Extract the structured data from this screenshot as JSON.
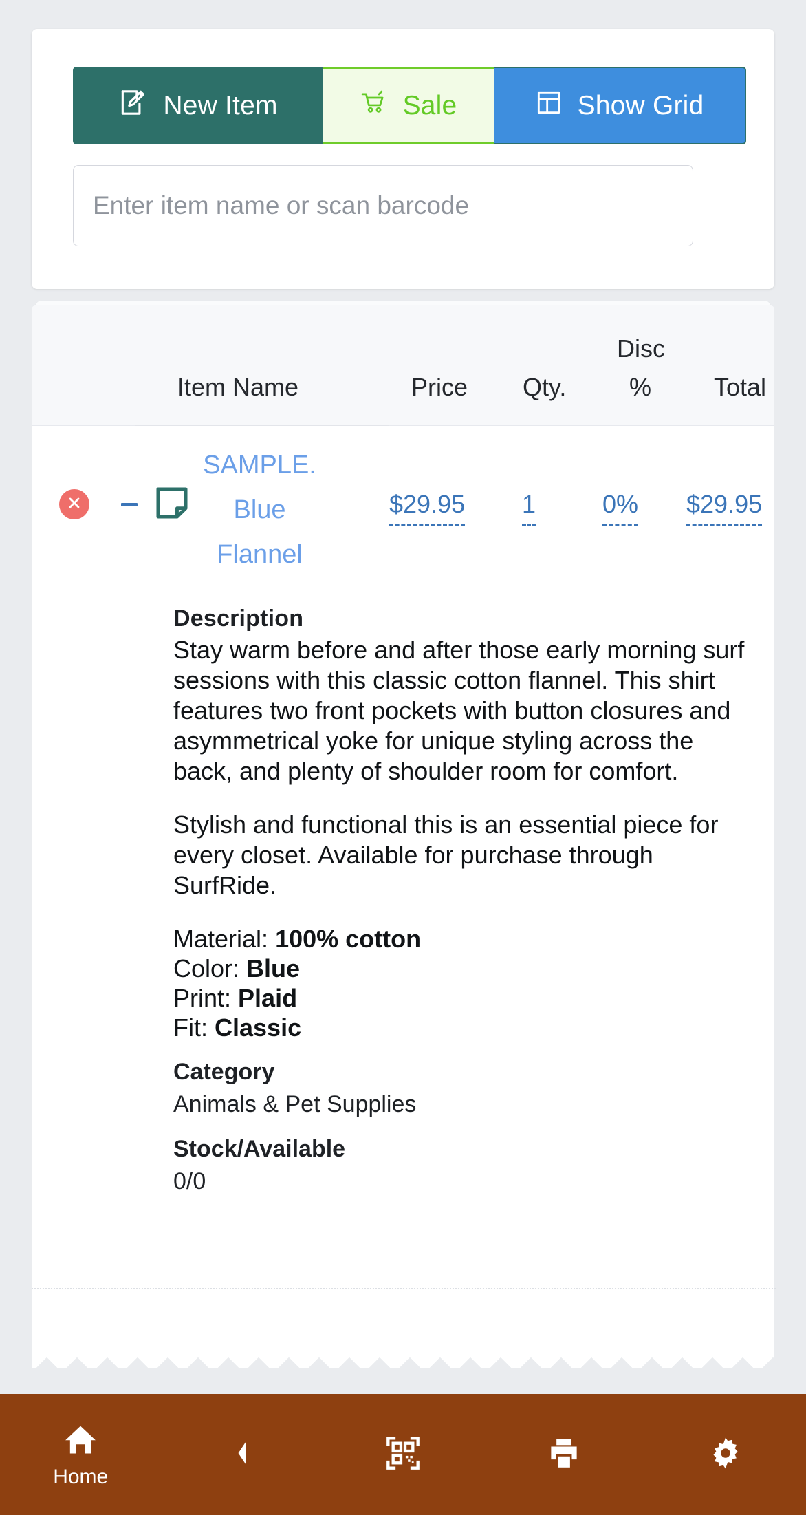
{
  "toolbar": {
    "new_item_label": "New Item",
    "sale_label": "Sale",
    "show_grid_label": "Show Grid",
    "new_item_icon": "edit-note-icon",
    "sale_icon": "shopping-cart-icon",
    "show_grid_icon": "grid-layout-icon",
    "colors": {
      "new_item_bg": "#2d7069",
      "sale_bg": "#f2fbe6",
      "sale_text": "#63ca26",
      "sale_border": "#6fcc2a",
      "show_grid_bg": "#3e8ede"
    }
  },
  "search": {
    "value": "",
    "placeholder": "Enter item name or scan barcode"
  },
  "table": {
    "headers": {
      "item_name": "Item Name",
      "price": "Price",
      "qty": "Qty.",
      "disc_top": "Disc",
      "disc_bottom": "%",
      "total": "Total"
    },
    "rows": [
      {
        "delete_icon": "remove-circle-icon",
        "expand_dash": "–",
        "note_icon": "note-icon",
        "name": "SAMPLE. Blue Flannel",
        "price": "$29.95",
        "qty": "1",
        "disc": "0%",
        "total": "$29.95"
      }
    ]
  },
  "detail": {
    "description_heading": "Description",
    "description_p1": "Stay warm before and after those early morning surf sessions with this classic cotton flannel. This shirt features two front pockets with button closures and asymmetrical yoke for unique styling across the back, and plenty of shoulder room for comfort.",
    "description_p2": "Stylish and functional this is an essential piece for every closet. Available for purchase through SurfRide.",
    "attributes": [
      {
        "label": "Material:",
        "value": "100% cotton"
      },
      {
        "label": "Color:",
        "value": "Blue"
      },
      {
        "label": "Print:",
        "value": "Plaid"
      },
      {
        "label": "Fit:",
        "value": "Classic"
      }
    ],
    "category_heading": "Category",
    "category_value": "Animals & Pet Supplies",
    "stock_heading": "Stock/Available",
    "stock_value": "0/0"
  },
  "bottom_nav": {
    "background": "#8e4010",
    "items": [
      {
        "icon": "home-icon",
        "label": "Home"
      },
      {
        "icon": "back-chevron-icon",
        "label": ""
      },
      {
        "icon": "qr-scan-icon",
        "label": ""
      },
      {
        "icon": "printer-icon",
        "label": ""
      },
      {
        "icon": "gear-icon",
        "label": ""
      }
    ]
  }
}
